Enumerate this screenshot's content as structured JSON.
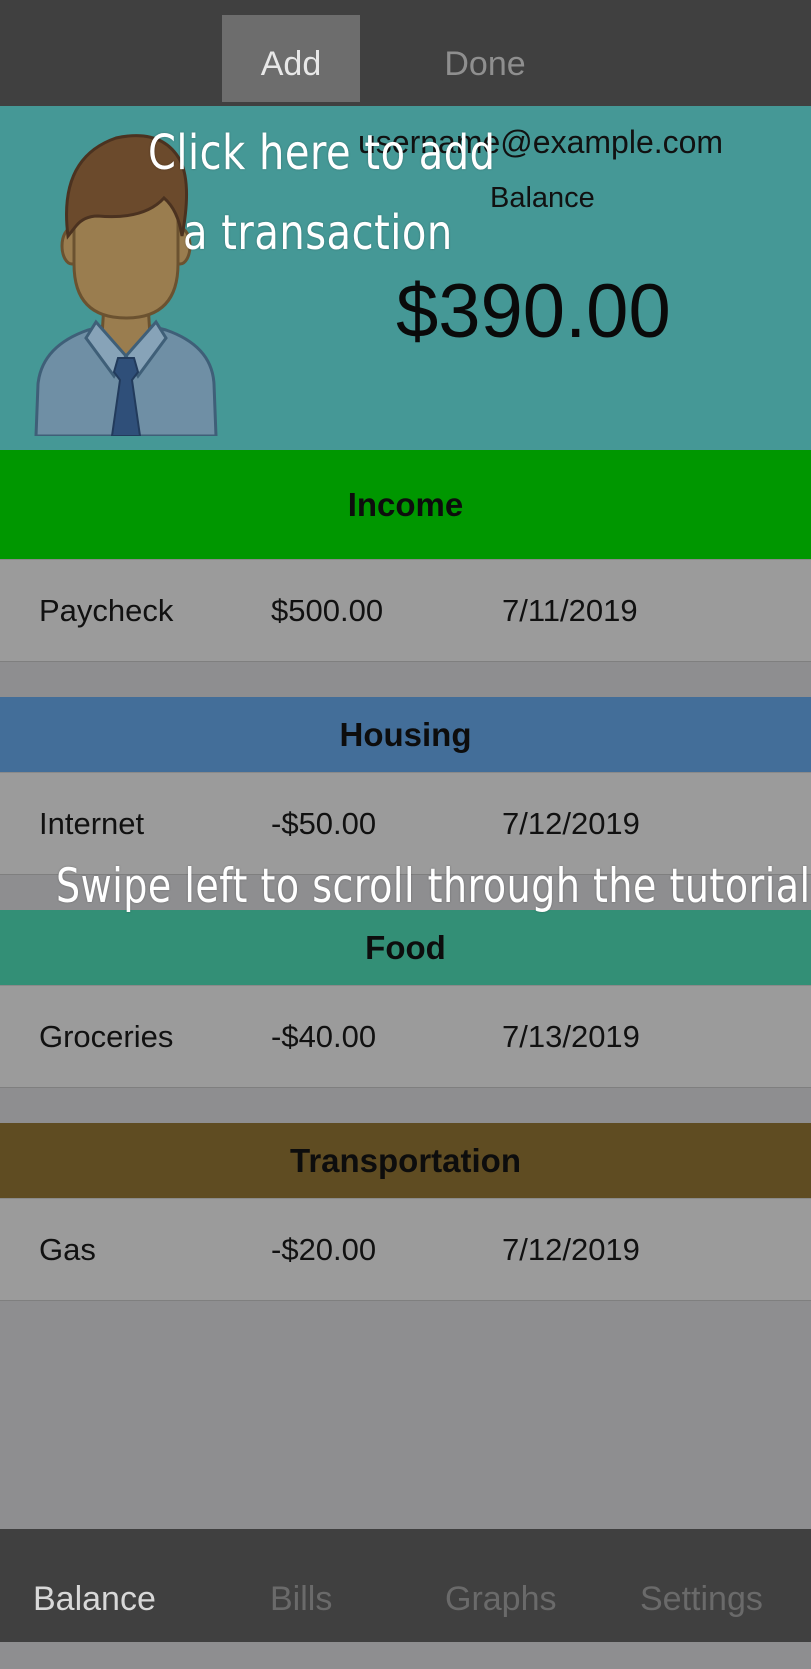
{
  "navbar": {
    "add_label": "Add",
    "done_label": "Done"
  },
  "header": {
    "email": "username@example.com",
    "balance_label": "Balance",
    "balance_amount": "$390.00"
  },
  "tutorial": {
    "add_hint_line1": "Click here to add",
    "add_hint_line2": "a transaction",
    "swipe_hint": "Swipe left to scroll through the tutorial"
  },
  "sections": [
    {
      "title": "Income",
      "color": "#009700",
      "rows": [
        {
          "name": "Paycheck",
          "amount": "$500.00",
          "date": "7/11/2019"
        }
      ]
    },
    {
      "title": "Housing",
      "color": "#436e99",
      "rows": [
        {
          "name": "Internet",
          "amount": "-$50.00",
          "date": "7/12/2019"
        }
      ]
    },
    {
      "title": "Food",
      "color": "#338f76",
      "rows": [
        {
          "name": "Groceries",
          "amount": "-$40.00",
          "date": "7/13/2019"
        }
      ]
    },
    {
      "title": "Transportation",
      "color": "#5f4c22",
      "rows": [
        {
          "name": "Gas",
          "amount": "-$20.00",
          "date": "7/12/2019"
        }
      ]
    }
  ],
  "tabs": [
    {
      "label": "Balance",
      "active": true
    },
    {
      "label": "Bills",
      "active": false
    },
    {
      "label": "Graphs",
      "active": false
    },
    {
      "label": "Settings",
      "active": false
    }
  ],
  "colors": {
    "navbar": "#404040",
    "header": "#459896",
    "row": "#9b9b9b",
    "background": "#8e8e90"
  }
}
